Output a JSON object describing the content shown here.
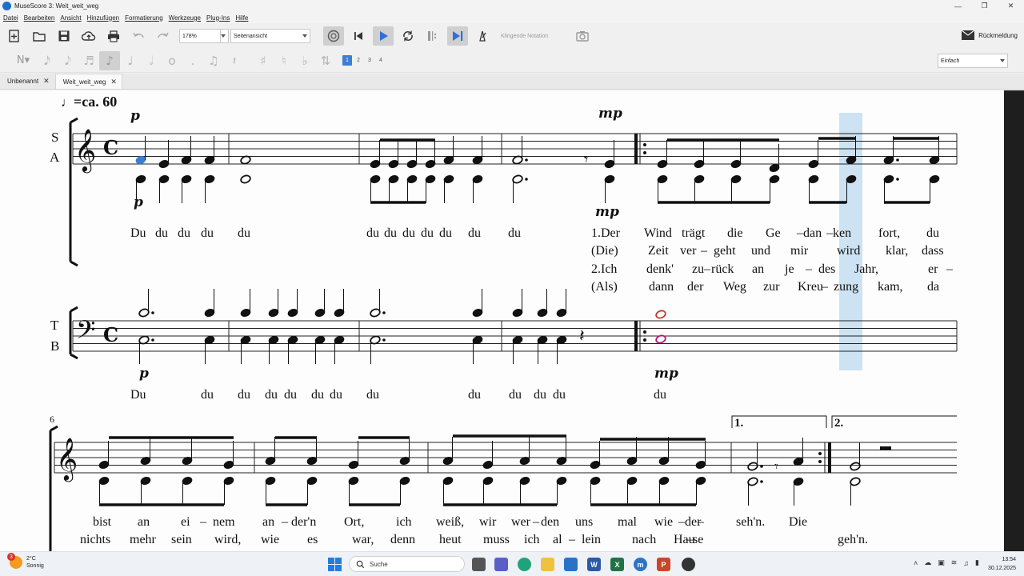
{
  "window": {
    "title": "MuseScore 3: Weit_weit_weg"
  },
  "menu": [
    "Datei",
    "Bearbeiten",
    "Ansicht",
    "Hinzufügen",
    "Formatierung",
    "Werkzeuge",
    "Plug-Ins",
    "Hilfe"
  ],
  "toolbar": {
    "zoom": "178%",
    "view_mode": "Seitenansicht",
    "concert_pitch": "Klingende Notation",
    "feedback": "Rückmeldung"
  },
  "note_input": {
    "voices": [
      "1",
      "2",
      "3",
      "4"
    ],
    "active_voice": "1",
    "workspace": "Einfach"
  },
  "tabs": [
    {
      "label": "Unbenannt",
      "active": false
    },
    {
      "label": "Weit_weit_weg",
      "active": true
    }
  ],
  "score": {
    "tempo": "=ca. 60",
    "staff_labels": {
      "upper_top": "S",
      "upper_bottom": "A",
      "lower_top": "T",
      "lower_bottom": "B"
    },
    "time_signature": "C",
    "dynamics": {
      "sop_start": "p",
      "alto_start": "p",
      "sop_m4": "mp",
      "alto_m4": "mp",
      "tb_start": "p",
      "tb_m5": "mp"
    },
    "measure_number_line2": "6",
    "volta_1": "1.",
    "volta_2": "2.",
    "lyrics_sa": {
      "line1": [
        "Du",
        "du",
        "du",
        "du",
        "du",
        "du",
        "du",
        "du",
        "du",
        "du",
        "du",
        "du",
        "1.Der",
        "Wind",
        "trägt",
        "die",
        "Ge",
        "–",
        "dan",
        "–",
        "ken",
        "fort,",
        "du"
      ],
      "line2": [
        "(Die)",
        "Zeit",
        "ver",
        "–",
        "geht",
        "und",
        "mir",
        "wird",
        "klar,",
        "dass"
      ],
      "line3": [
        "2.Ich",
        "denk'",
        "zu",
        "–",
        "rück",
        "an",
        "je",
        "–",
        "des",
        "Jahr,",
        "er",
        "–"
      ],
      "line4": [
        "(Als)",
        "dann",
        "der",
        "Weg",
        "zur",
        "Kreu",
        "–",
        "zung",
        "kam,",
        "da"
      ]
    },
    "lyrics_tb": [
      "Du",
      "du",
      "du",
      "du",
      "du",
      "du",
      "du",
      "du",
      "du",
      "du",
      "du",
      "du",
      "du"
    ],
    "lyrics_line2_1": [
      "bist",
      "an",
      "ei",
      "–",
      "nem",
      "an",
      "–",
      "der'n",
      "Ort,",
      "ich",
      "weiß,",
      "wir",
      "wer",
      "–",
      "den",
      "uns",
      "mal",
      "wie",
      "–",
      "der",
      "–",
      "seh'n.",
      "Die"
    ],
    "lyrics_line2_2": [
      "nichts",
      "mehr",
      "sein",
      "wird,",
      "wie",
      "es",
      "war,",
      "denn",
      "heut",
      "muss",
      "ich",
      "al",
      "–",
      "lein",
      "nach",
      "Hau",
      "–",
      "se",
      "geh'n."
    ]
  },
  "taskbar": {
    "weather_temp": "2°C",
    "weather_desc": "Sonnig",
    "weather_badge": "3",
    "search": "Suche",
    "time": "13:54",
    "date": "30.12.2025"
  }
}
